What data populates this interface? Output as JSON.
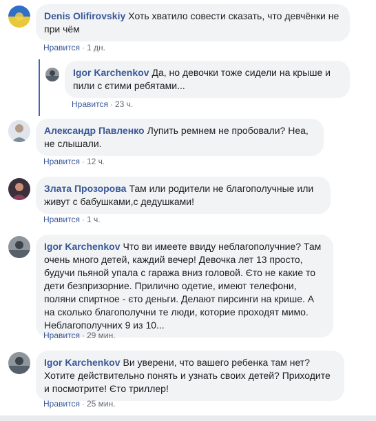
{
  "comments": [
    {
      "author": "Denis Olifirovskiy",
      "text": "Хоть хватило совести сказать, что девчёнки не при чём",
      "like": "Нравится",
      "time": "1 дн."
    },
    {
      "author": "Igor Karchenkov",
      "text": "Да, но девочки тоже сидели на крыше и пили с єтими ребятами...",
      "like": "Нравится",
      "time": "23 ч."
    },
    {
      "author": "Александр Павленко",
      "text": "Лупить ремнем не пробовали? Неа, не слышали.",
      "like": "Нравится",
      "time": "12 ч."
    },
    {
      "author": "Злата Прозорова",
      "text": "Там или родители не благополучные или живут с бабушками,с дедушками!",
      "like": "Нравится",
      "time": "1 ч."
    },
    {
      "author": "Igor Karchenkov",
      "text": "Что ви имеете ввиду неблагополучние? Там очень много детей, каждий вечер! Девочка лет 13 просто, будучи пьяной упала с гаража вниз головой. Єто не какие то дети безпризорние. Прилично одетие, имеют телефони, поляни спиртное - єто деньги. Делают пирсинги на крише. А на сколько благополучни те люди, которие проходят мимо. Неблагополучних 9 из 10...",
      "like": "Нравится",
      "time": "29 мин."
    },
    {
      "author": "Igor Karchenkov",
      "text": "Ви уверени, что вашего ребенка там нет? Хотите действительно понять и узнать своих детей? Приходите и посмотрите! Єто триллер!",
      "like": "Нравится",
      "time": "25 мин."
    }
  ],
  "separator": "·",
  "colors": {
    "link": "#385898",
    "bubble": "#f2f3f5",
    "meta": "#616770",
    "thread_line": "#4267b2"
  }
}
